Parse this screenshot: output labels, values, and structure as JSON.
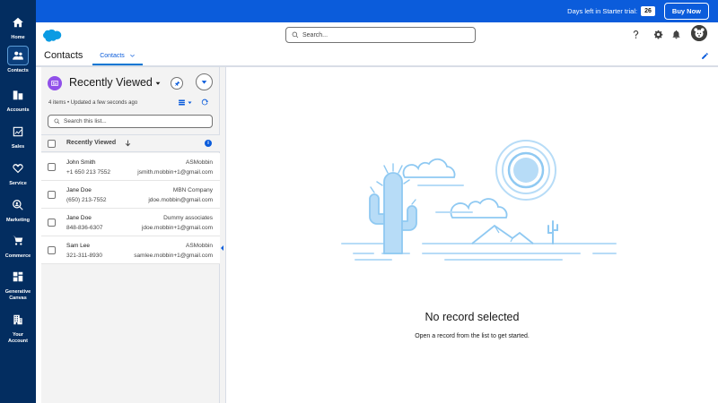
{
  "nav": {
    "items": [
      {
        "label": "Home",
        "icon": "home-icon"
      },
      {
        "label": "Contacts",
        "icon": "contacts-icon"
      },
      {
        "label": "Accounts",
        "icon": "accounts-icon"
      },
      {
        "label": "Sales",
        "icon": "sales-chart-icon"
      },
      {
        "label": "Service",
        "icon": "heart-icon"
      },
      {
        "label": "Marketing",
        "icon": "marketing-search-icon"
      },
      {
        "label": "Commerce",
        "icon": "cart-icon"
      },
      {
        "label": "Generative Canvas",
        "icon": "canvas-icon"
      },
      {
        "label": "Your Account",
        "icon": "building-icon"
      }
    ],
    "active": "Contacts"
  },
  "trial": {
    "text": "Days left in Starter trial:",
    "days": "26",
    "buy_label": "Buy Now"
  },
  "header": {
    "search_placeholder": "Search..."
  },
  "appnav": {
    "title": "Contacts",
    "tab_label": "Contacts"
  },
  "listview": {
    "title": "Recently Viewed",
    "status": "4 items • Updated a few seconds ago",
    "search_placeholder": "Search this list...",
    "column_header": "Recently Viewed",
    "rows": [
      {
        "name": "John Smith",
        "phone": "+1 650 213 7552",
        "company": "ASMobbin",
        "email": "jsmith.mobbin+1@gmail.com"
      },
      {
        "name": "Jane Doe",
        "phone": "(650) 213-7552",
        "company": "MBN Company",
        "email": "jdoe.mobbin@gmail.com"
      },
      {
        "name": "Jane Doe",
        "phone": "848-836-6307",
        "company": "Dummy associates",
        "email": "jdoe.mobbin+1@gmail.com"
      },
      {
        "name": "Sam Lee",
        "phone": "321-311-8930",
        "company": "ASMobbin",
        "email": "samlee.mobbin+1@gmail.com"
      }
    ]
  },
  "detail": {
    "empty_title": "No record selected",
    "empty_subtitle": "Open a record from the list to get started."
  },
  "colors": {
    "nav_bg": "#032d60",
    "banner_bg": "#0b5cdb",
    "accent": "#0176d3",
    "listview_icon": "#9050e9"
  }
}
